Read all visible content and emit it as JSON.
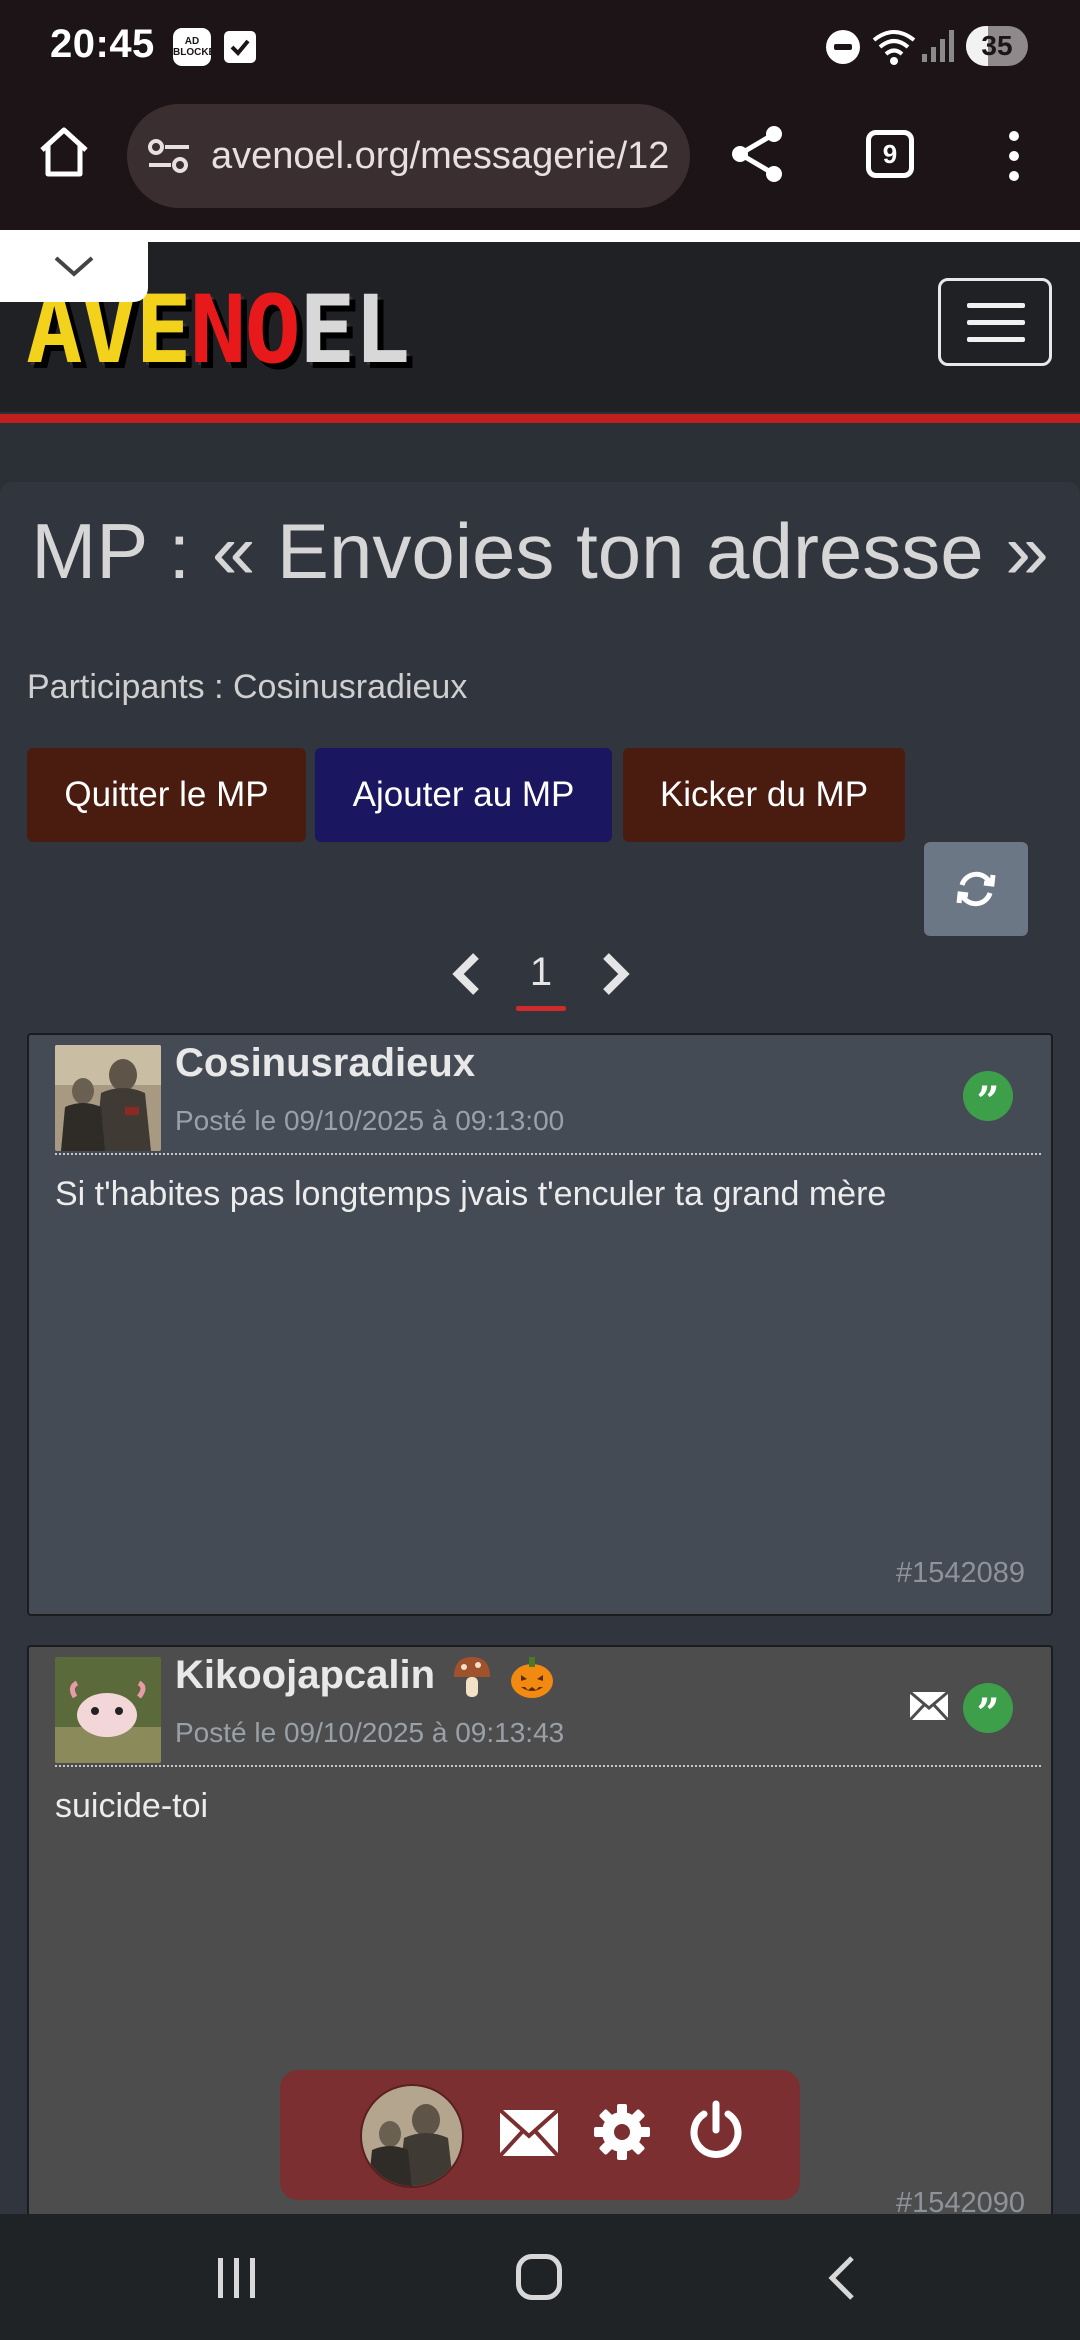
{
  "status_bar": {
    "time": "20:45",
    "adblock_label": "AD BLOCKER",
    "battery_level": 35,
    "battery_text": "35",
    "icons": [
      "adblock-icon",
      "check-box-icon",
      "do-not-disturb-icon",
      "wifi-icon",
      "signal-icon",
      "battery-icon"
    ]
  },
  "browser": {
    "url": "avenoel.org/messagerie/12",
    "tabs_count": "9"
  },
  "site": {
    "logo_letters": [
      {
        "ch": "A",
        "color": "#f3d21c"
      },
      {
        "ch": "V",
        "color": "#f3d21c"
      },
      {
        "ch": "E",
        "color": "#f3d21c"
      },
      {
        "ch": "N",
        "color": "#e8191b"
      },
      {
        "ch": "O",
        "color": "#e8191b"
      },
      {
        "ch": "E",
        "color": "#d8d8d8"
      },
      {
        "ch": "L",
        "color": "#d8d8d8"
      }
    ],
    "accent_red": "#c0201e"
  },
  "conversation": {
    "title": "MP : « Envoies ton adresse »",
    "participants": "Participants : Cosinusradieux",
    "buttons": {
      "quit": "Quitter le MP",
      "add": "Ajouter au MP",
      "kick": "Kicker du MP"
    },
    "current_page": "1"
  },
  "posts": [
    {
      "author": "Cosinusradieux",
      "date": "Posté le 09/10/2025 à 09:13:00",
      "body": "Si t'habites pas longtemps jvais t'enculer ta grand mère",
      "id": "#1542089"
    },
    {
      "author": "Kikoojapcalin",
      "emojis": [
        "mushroom-emoji",
        "pumpkin-emoji"
      ],
      "date": "Posté le 09/10/2025 à 09:13:43",
      "body": "suicide-toi",
      "id": "#1542090"
    }
  ],
  "quote_glyph": "”"
}
